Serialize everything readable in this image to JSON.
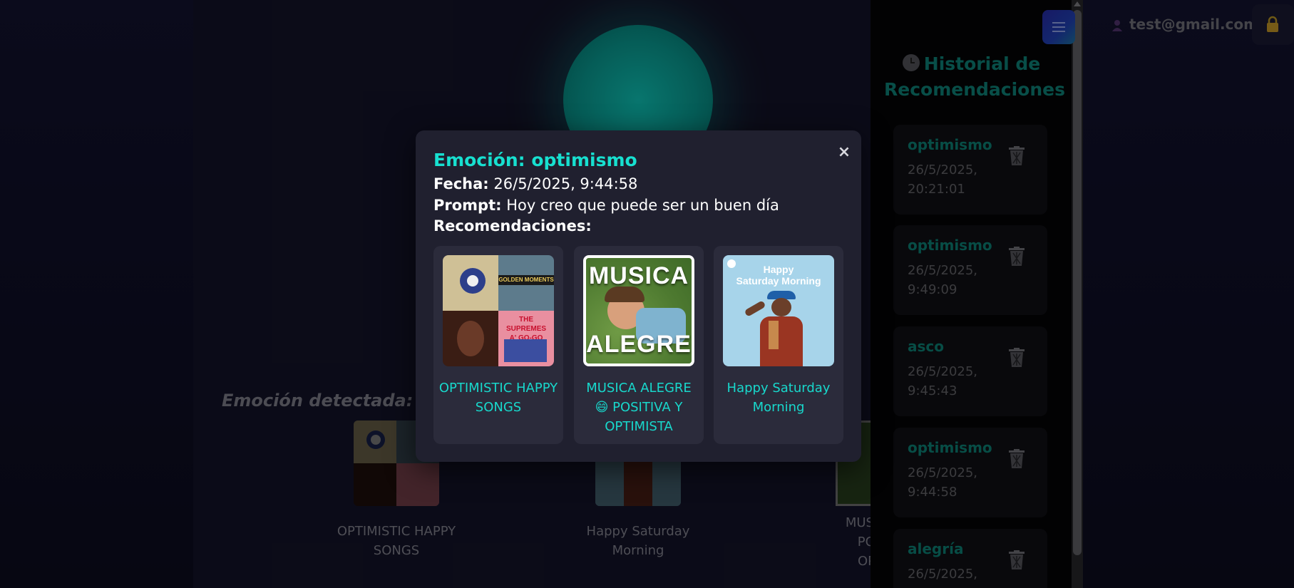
{
  "header": {
    "user_email": "test@gmail.com",
    "icons": [
      "menu-icon",
      "user-icon",
      "lock-icon"
    ]
  },
  "main": {
    "detected_prefix": "Emoción detectada: op",
    "recommendations": [
      {
        "title_lines": [
          "OPTIMISTIC HAPPY",
          "SONGS"
        ]
      },
      {
        "title_lines": [
          "Happy Saturday",
          "Morning"
        ]
      },
      {
        "title_lines": [
          "MUSICA",
          "POS",
          "OPT"
        ]
      }
    ]
  },
  "sidebar": {
    "title": "Historial de Recomendaciones",
    "title_icon": "clock-icon",
    "items": [
      {
        "emotion": "optimismo",
        "date": "26/5/2025,",
        "time": "20:21:01"
      },
      {
        "emotion": "optimismo",
        "date": "26/5/2025,",
        "time": "9:49:09"
      },
      {
        "emotion": "asco",
        "date": "26/5/2025,",
        "time": "9:45:43"
      },
      {
        "emotion": "optimismo",
        "date": "26/5/2025,",
        "time": "9:44:58"
      },
      {
        "emotion": "alegría",
        "date": "26/5/2025,",
        "time": ""
      }
    ]
  },
  "modal": {
    "close": "×",
    "title": "Emoción: optimismo",
    "fecha_label": "Fecha:",
    "fecha_value": " 26/5/2025, 9:44:58",
    "prompt_label": "Prompt:",
    "prompt_value": " Hoy creo que puede ser un buen día",
    "recs_label": "Recomendaciones:",
    "recs": [
      {
        "title": "OPTIMISTIC HAPPY SONGS",
        "cover_texts": [
          "GOLDEN MOMENTS",
          "THE SUPREMES",
          "A' GO-GO"
        ]
      },
      {
        "title": "MUSICA ALEGRE 😄 POSITIVA Y OPTIMISTA",
        "cover_texts": [
          "MUSICA",
          "ALEGRE"
        ]
      },
      {
        "title": "Happy Saturday Morning",
        "cover_texts": [
          "Happy",
          "Saturday Morning"
        ]
      }
    ]
  },
  "colors": {
    "accent_teal": "#17e0d0",
    "history_teal": "#0f8f83",
    "modal_bg": "#20202f",
    "card_bg": "#2b2b3b"
  }
}
